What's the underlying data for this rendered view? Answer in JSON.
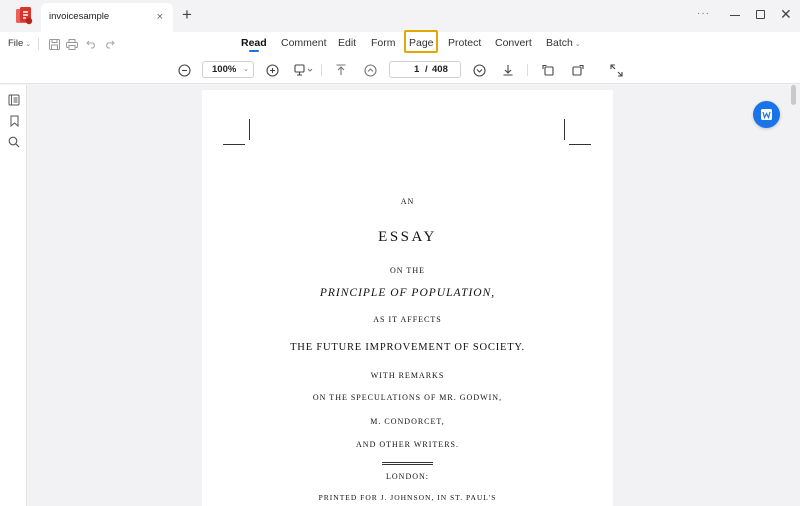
{
  "window": {
    "tab_title": "invoicesample",
    "tab_close": "×",
    "new_tab": "+",
    "more": "···",
    "close": "✕"
  },
  "menubar": {
    "file_label": "File",
    "items": [
      {
        "label": "Read",
        "active": true
      },
      {
        "label": "Comment"
      },
      {
        "label": "Edit"
      },
      {
        "label": "Form"
      },
      {
        "label": "Page",
        "highlighted": true
      },
      {
        "label": "Protect"
      },
      {
        "label": "Convert"
      },
      {
        "label": "Batch"
      }
    ]
  },
  "toolbar": {
    "zoom": "100%",
    "page_current": "1",
    "page_separator": "/",
    "page_total": "408"
  },
  "document": {
    "lines": [
      "AN",
      "ESSAY",
      "ON THE",
      "PRINCIPLE OF POPULATION,",
      "AS IT AFFECTS",
      "THE FUTURE IMPROVEMENT OF SOCIETY.",
      "WITH REMARKS",
      "ON THE SPECULATIONS OF MR. GODWIN,",
      "M. CONDORCET,",
      "AND OTHER WRITERS.",
      "LONDON:",
      "PRINTED FOR J. JOHNSON, IN ST. PAUL'S"
    ]
  },
  "colors": {
    "accent": "#1a73e8",
    "highlight": "#e0a800",
    "logo": "#d9342b"
  }
}
